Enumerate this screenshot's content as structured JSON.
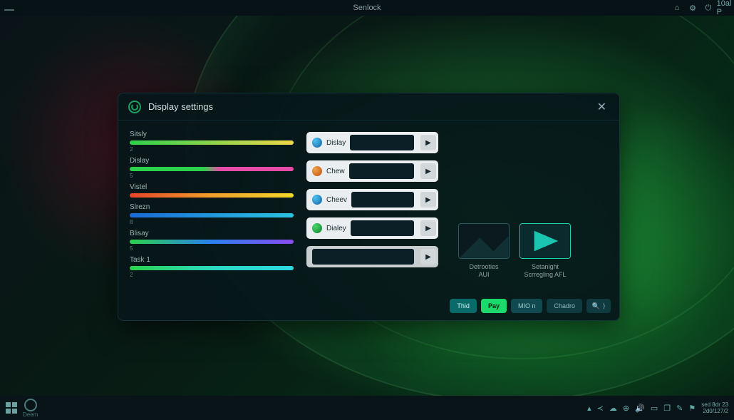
{
  "topbar": {
    "title": "Senlock",
    "clock": "10al P"
  },
  "window": {
    "title": "Display settings",
    "sliders": [
      {
        "label": "Sitsly",
        "sub": "2",
        "grad": "g-green-yellow"
      },
      {
        "label": "Dislay",
        "sub": "5",
        "grad": "g-green-pink"
      },
      {
        "label": "Vistel",
        "sub": "",
        "grad": "g-fire"
      },
      {
        "label": "Slrezn",
        "sub": "8",
        "grad": "g-ice"
      },
      {
        "label": "Blisay",
        "sub": "5",
        "grad": "g-green-blue"
      },
      {
        "label": "Task 1",
        "sub": "2",
        "grad": "g-green-cyan"
      }
    ],
    "dropdowns": [
      {
        "icon": "dd-blue",
        "label": "Dislay"
      },
      {
        "icon": "dd-orange",
        "label": "Chew"
      },
      {
        "icon": "dd-blue",
        "label": "Cheev"
      },
      {
        "icon": "dd-green",
        "label": "Dialey"
      },
      {
        "icon": "",
        "label": ""
      }
    ],
    "previews": [
      {
        "label": "Detrooties\nAUI"
      },
      {
        "label": "Setanight\nScrregling AFL"
      }
    ],
    "footer": {
      "b1": "Thid",
      "b2": "Pay",
      "b3": "MIO n",
      "b4": "Chadro",
      "search": "Q"
    }
  },
  "taskbar": {
    "start_label": "",
    "circle_label": "Deem",
    "time_l1": "sed 8dr 23",
    "time_l2": "2d0/127/2"
  }
}
